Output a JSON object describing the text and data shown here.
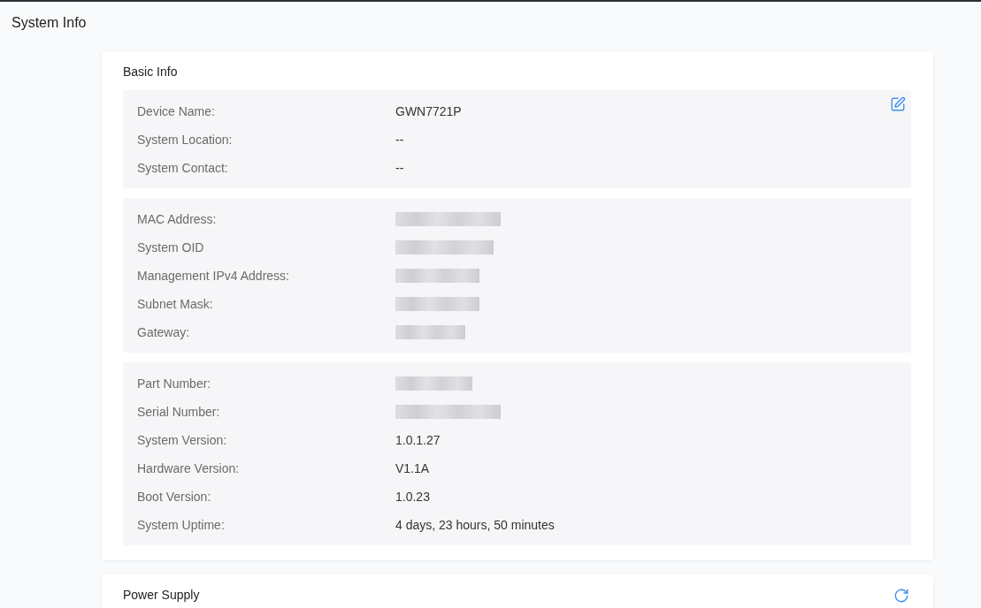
{
  "page": {
    "title": "System Info"
  },
  "basic_info": {
    "title": "Basic Info",
    "groups": [
      {
        "editable": true,
        "rows": [
          {
            "label": "Device Name:",
            "redacted": false,
            "value": "GWN7721P"
          },
          {
            "label": "System Location:",
            "redacted": false,
            "value": "--"
          },
          {
            "label": "System Contact:",
            "redacted": false,
            "value": "--"
          }
        ]
      },
      {
        "editable": false,
        "rows": [
          {
            "label": "MAC Address:",
            "redacted": true
          },
          {
            "label": "System OID",
            "redacted": true
          },
          {
            "label": "Management IPv4 Address:",
            "redacted": true
          },
          {
            "label": "Subnet Mask:",
            "redacted": true
          },
          {
            "label": "Gateway:",
            "redacted": true
          }
        ]
      },
      {
        "editable": false,
        "rows": [
          {
            "label": "Part Number:",
            "redacted": true
          },
          {
            "label": "Serial Number:",
            "redacted": true
          },
          {
            "label": "System Version:",
            "redacted": false,
            "value": "1.0.1.27"
          },
          {
            "label": "Hardware Version:",
            "redacted": false,
            "value": "V1.1A"
          },
          {
            "label": "Boot Version:",
            "redacted": false,
            "value": "1.0.23"
          },
          {
            "label": "System Uptime:",
            "redacted": false,
            "value": "4 days, 23 hours, 50 minutes"
          }
        ]
      }
    ]
  },
  "power_supply": {
    "title": "Power Supply"
  }
}
